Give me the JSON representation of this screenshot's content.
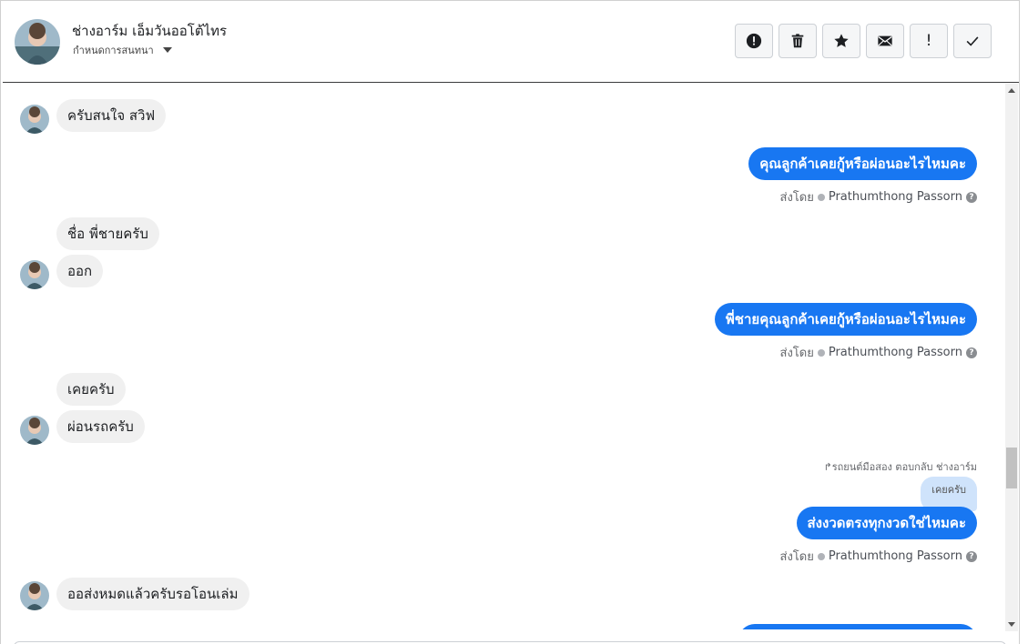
{
  "header": {
    "title": "ช่างอาร์ม เอ็มวันออโต้ไทร",
    "subtitle": "กำหนดการสนทนา",
    "actions": [
      {
        "name": "report-button",
        "icon": "alert-circle-icon"
      },
      {
        "name": "delete-button",
        "icon": "trash-icon"
      },
      {
        "name": "star-button",
        "icon": "star-icon"
      },
      {
        "name": "mail-button",
        "icon": "envelope-icon"
      },
      {
        "name": "important-button",
        "icon": "exclamation-icon",
        "glyph": "!"
      },
      {
        "name": "done-button",
        "icon": "checkmark-icon"
      }
    ]
  },
  "messages": {
    "m1": "ครับสนใจ สวิฟ",
    "m2": "คุณลูกค้าเคยกู้หรือผ่อนอะไรไหมคะ",
    "m3": "ชื่อ พี่ชายครับ",
    "m4": "ออก",
    "m5": "พี่ชายคุณลูกค้าเคยกู้หรือผ่อนอะไรไหมคะ",
    "m6": "เคยครับ",
    "m7": "ผ่อนรถครับ",
    "reply_note": "รถยนต์มือสอง ตอบกลับ ช่างอาร์ม",
    "quoted": "เคยครับ",
    "m8": "ส่งงวดตรงทุกงวดใช่ไหมคะ",
    "m9": "ออส่งหมดแล้วครับรอโอนเล่ม"
  },
  "sent_by": {
    "label": "ส่งโดย",
    "name": "Prathumthong Passorn",
    "help": "?"
  },
  "colors": {
    "outgoing_bubble": "#1877f2",
    "incoming_bubble": "#f0f0f0",
    "quoted_bubble": "#cfe3fb"
  }
}
